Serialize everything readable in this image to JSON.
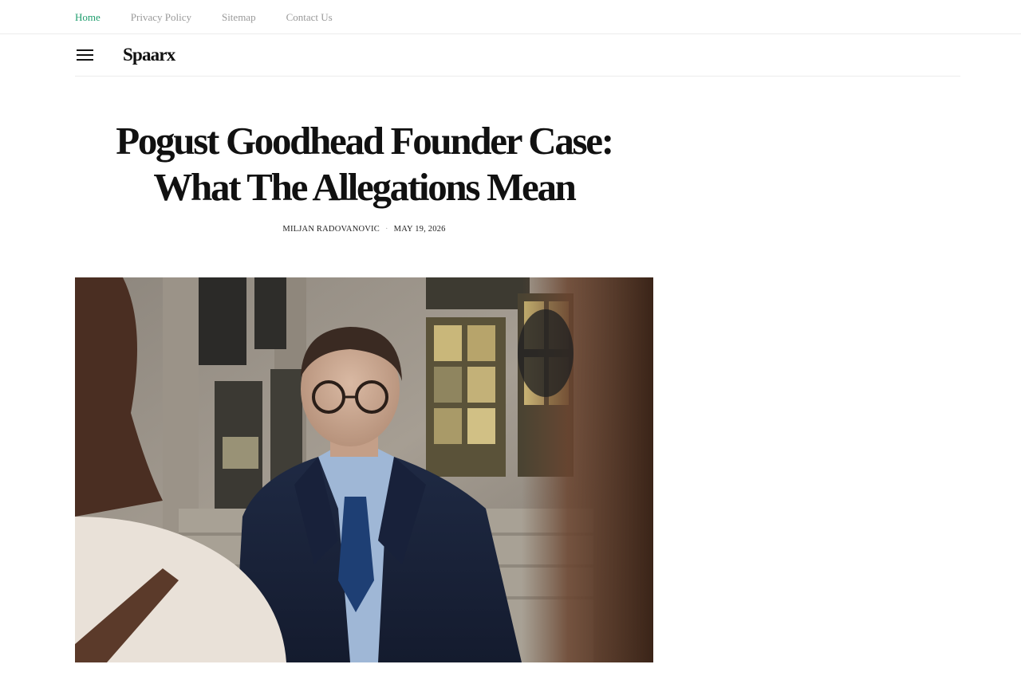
{
  "topnav": {
    "items": [
      {
        "label": "Home",
        "active": true
      },
      {
        "label": "Privacy Policy",
        "active": false
      },
      {
        "label": "Sitemap",
        "active": false
      },
      {
        "label": "Contact Us",
        "active": false
      }
    ],
    "active_color": "#1f9e6e"
  },
  "header": {
    "menu_icon": "hamburger-menu-icon",
    "logo": "Spaarx"
  },
  "article": {
    "title_line1": "Pogust Goodhead Founder Case:",
    "title_line2": "What The Allegations Mean",
    "author": "MILJAN RADOVANOVIC",
    "separator": "·",
    "date": "MAY 19, 2026"
  }
}
